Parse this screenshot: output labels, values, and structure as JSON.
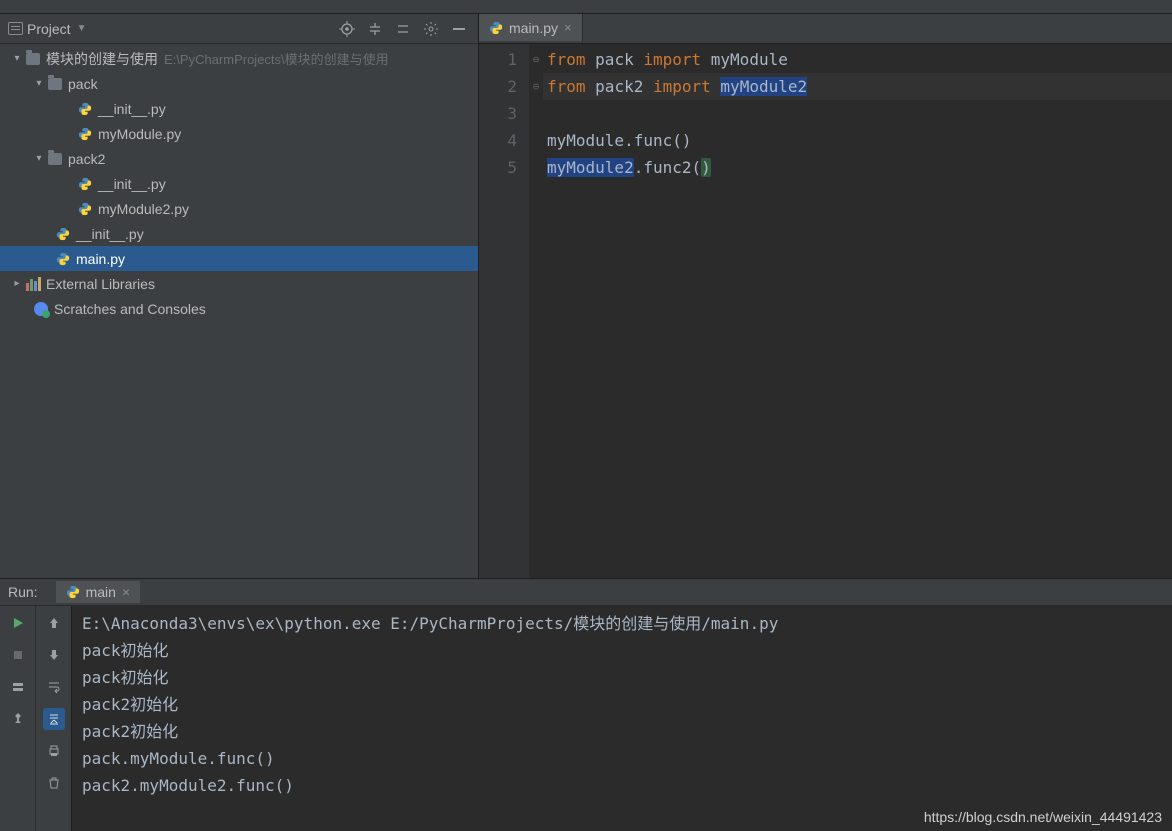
{
  "project_panel": {
    "title": "Project",
    "root": {
      "name": "模块的创建与使用",
      "path": "E:\\PyCharmProjects\\模块的创建与使用"
    },
    "pack": {
      "name": "pack",
      "init": "__init__.py",
      "module": "myModule.py"
    },
    "pack2": {
      "name": "pack2",
      "init": "__init__.py",
      "module": "myModule2.py"
    },
    "root_init": "__init__.py",
    "main": "main.py",
    "external": "External Libraries",
    "scratch": "Scratches and Consoles"
  },
  "editor": {
    "tab": "main.py",
    "lines": [
      "1",
      "2",
      "3",
      "4",
      "5"
    ],
    "code": {
      "l1": {
        "kw1": "from",
        "mod": "pack",
        "kw2": "import",
        "name": "myModule"
      },
      "l2": {
        "kw1": "from",
        "mod": "pack2",
        "kw2": "import",
        "name": "myModule2"
      },
      "l4": "myModule.func()",
      "l5a": "myModule2",
      "l5b": ".func2(",
      "l5c": ")"
    }
  },
  "run": {
    "label": "Run:",
    "tab": "main",
    "lines": [
      "E:\\Anaconda3\\envs\\ex\\python.exe E:/PyCharmProjects/模块的创建与使用/main.py",
      "pack初始化",
      "pack初始化",
      "pack2初始化",
      "pack2初始化",
      "pack.myModule.func()",
      "pack2.myModule2.func()"
    ]
  },
  "watermark": "https://blog.csdn.net/weixin_44491423"
}
